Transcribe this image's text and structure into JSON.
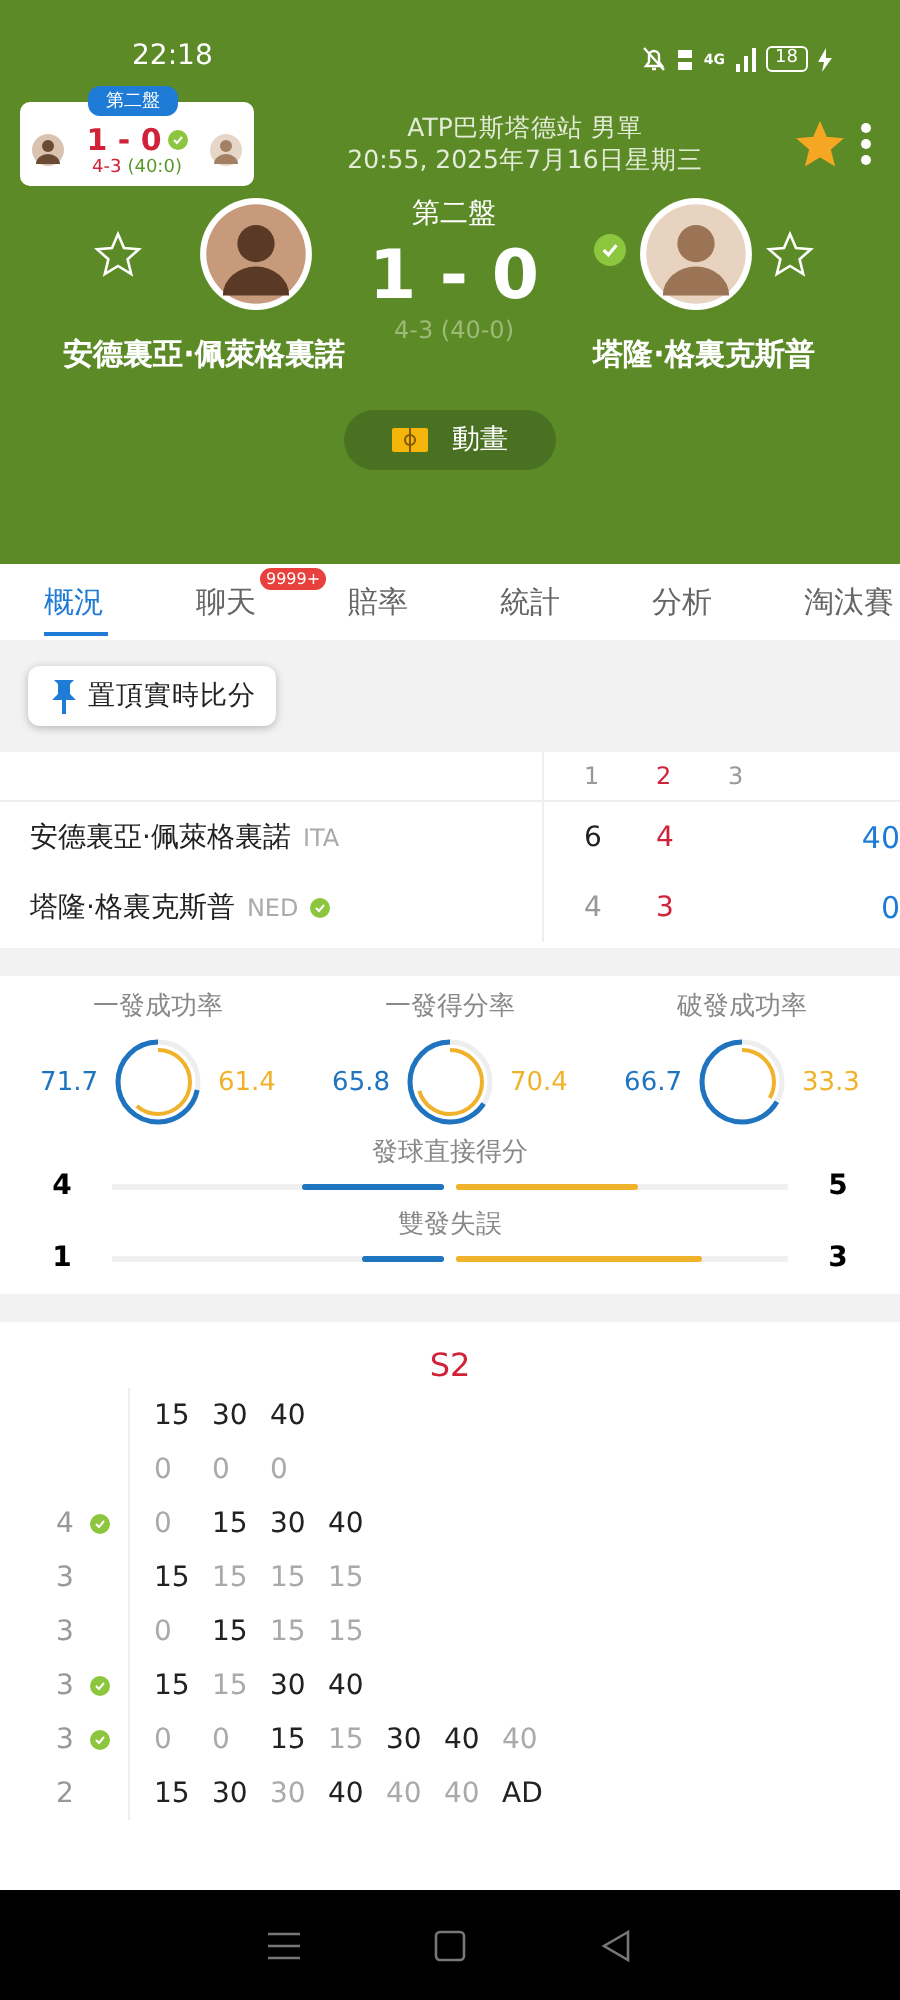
{
  "status_bar": {
    "time": "22:18",
    "network": "4G",
    "battery": "18"
  },
  "mini_card": {
    "set_label": "第二盤",
    "score": "1 - 0",
    "games": "4-3",
    "points": "(40:0)"
  },
  "match": {
    "tournament": "ATP巴斯塔德站 男單",
    "datetime": "20:55, 2025年7月16日星期三",
    "favorite": true
  },
  "scoreboard": {
    "set_label": "第二盤",
    "score": "1 - 0",
    "sub": "4-3 (40-0)",
    "animation_button": "動畫",
    "players": [
      {
        "name": "安德裏亞·佩萊格裏諾",
        "serving": false,
        "followed": false
      },
      {
        "name": "塔隆·格裏克斯普",
        "serving": true,
        "followed": false
      }
    ]
  },
  "tabs": [
    {
      "label": "概況",
      "selected": true
    },
    {
      "label": "聊天",
      "selected": false,
      "badge": "9999+"
    },
    {
      "label": "賠率",
      "selected": false
    },
    {
      "label": "統計",
      "selected": false
    },
    {
      "label": "分析",
      "selected": false
    },
    {
      "label": "淘汰賽",
      "selected": false
    }
  ],
  "pin_button": "置頂實時比分",
  "score_table": {
    "set_columns": [
      {
        "label": "1",
        "current": false
      },
      {
        "label": "2",
        "current": true
      },
      {
        "label": "3",
        "current": false
      }
    ],
    "rows": [
      {
        "name": "安德裏亞·佩萊格裏諾",
        "country": "ITA",
        "serving": false,
        "sets": [
          "6",
          "4"
        ],
        "point": "40"
      },
      {
        "name": "塔隆·格裏克斯普",
        "country": "NED",
        "serving": true,
        "sets": [
          "4",
          "3"
        ],
        "point": "0"
      }
    ]
  },
  "rings": [
    {
      "label": "一發成功率",
      "left": {
        "value": "71.7"
      },
      "right": {
        "value": "61.4"
      }
    },
    {
      "label": "一發得分率",
      "left": {
        "value": "65.8"
      },
      "right": {
        "value": "70.4"
      }
    },
    {
      "label": "破發成功率",
      "left": {
        "value": "66.7"
      },
      "right": {
        "value": "33.3"
      }
    }
  ],
  "bars": [
    {
      "label": "發球直接得分",
      "left": {
        "value": "4",
        "level": 0.43
      },
      "right": {
        "value": "5",
        "level": 0.55
      }
    },
    {
      "label": "雙發失誤",
      "left": {
        "value": "1",
        "level": 0.25
      },
      "right": {
        "value": "3",
        "level": 0.74
      }
    }
  ],
  "point_by_point": {
    "title": "S2",
    "games": [
      {
        "rows": [
          {
            "points": [
              {
                "p": "15",
                "won": true
              },
              {
                "p": "30",
                "won": true
              },
              {
                "p": "40",
                "won": true
              }
            ]
          },
          {
            "points": [
              {
                "p": "0",
                "won": false
              },
              {
                "p": "0",
                "won": false
              },
              {
                "p": "0",
                "won": false
              }
            ]
          }
        ]
      },
      {
        "rows": [
          {
            "score": "4",
            "serving": true,
            "points": [
              {
                "p": "0",
                "won": false
              },
              {
                "p": "15",
                "won": true
              },
              {
                "p": "30",
                "won": true
              },
              {
                "p": "40",
                "won": true
              }
            ]
          },
          {
            "score": "3",
            "serving": false,
            "points": [
              {
                "p": "15",
                "won": true
              },
              {
                "p": "15",
                "won": false
              },
              {
                "p": "15",
                "won": false
              },
              {
                "p": "15",
                "won": false
              }
            ]
          }
        ]
      },
      {
        "rows": [
          {
            "score": "3",
            "serving": false,
            "points": [
              {
                "p": "0",
                "won": false
              },
              {
                "p": "15",
                "won": true
              },
              {
                "p": "15",
                "won": false
              },
              {
                "p": "15",
                "won": false
              }
            ]
          },
          {
            "score": "3",
            "serving": true,
            "points": [
              {
                "p": "15",
                "won": true
              },
              {
                "p": "15",
                "won": false
              },
              {
                "p": "30",
                "won": true
              },
              {
                "p": "40",
                "won": true
              }
            ]
          }
        ]
      },
      {
        "rows": [
          {
            "score": "3",
            "serving": true,
            "points": [
              {
                "p": "0",
                "won": false
              },
              {
                "p": "0",
                "won": false
              },
              {
                "p": "15",
                "won": true
              },
              {
                "p": "15",
                "won": false
              },
              {
                "p": "30",
                "won": true
              },
              {
                "p": "40",
                "won": true
              },
              {
                "p": "40",
                "won": false
              }
            ]
          },
          {
            "score": "2",
            "serving": false,
            "points": [
              {
                "p": "15",
                "won": true
              },
              {
                "p": "30",
                "won": true
              },
              {
                "p": "30",
                "won": false
              },
              {
                "p": "40",
                "won": true
              },
              {
                "p": "40",
                "won": false
              },
              {
                "p": "40",
                "won": false
              },
              {
                "p": "AD",
                "won": true
              }
            ]
          }
        ]
      }
    ]
  }
}
